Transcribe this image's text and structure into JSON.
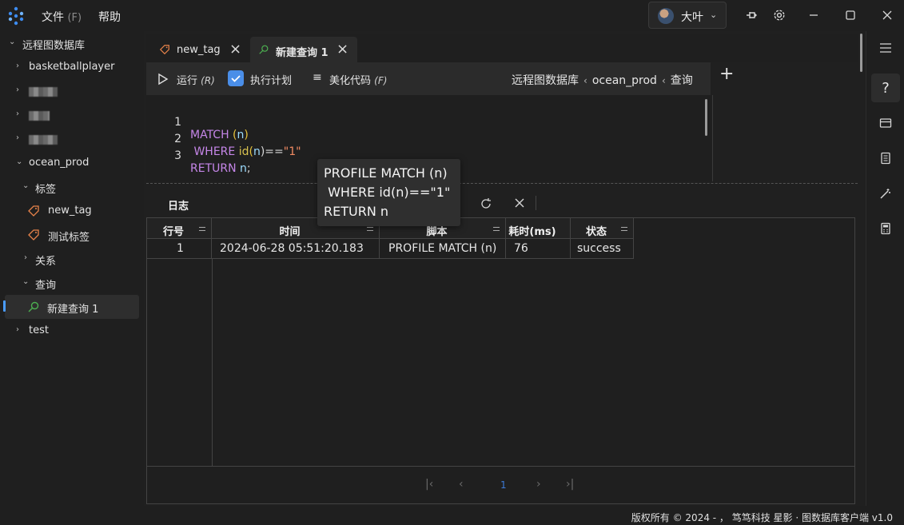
{
  "menu": {
    "file_label": "文件",
    "file_hint": "(F)",
    "help_label": "帮助"
  },
  "user": {
    "name": "大叶"
  },
  "sidebar": {
    "root": "远程图数据库",
    "items": [
      {
        "label": "basketballplayer"
      },
      {
        "label": "ocean_prod"
      },
      {
        "label": "标签"
      },
      {
        "label": "new_tag"
      },
      {
        "label": "测试标签"
      },
      {
        "label": "关系"
      },
      {
        "label": "查询"
      },
      {
        "label": "新建查询 1"
      },
      {
        "label": "test"
      }
    ]
  },
  "tabs": [
    {
      "label": "new_tag"
    },
    {
      "label": "新建查询 1"
    }
  ],
  "toolbar": {
    "run_label": "运行",
    "run_hint": "(R)",
    "plan_label": "执行计划",
    "beautify_label": "美化代码",
    "beautify_hint": "(F)",
    "breadcrumb": [
      "远程图数据库",
      "ocean_prod",
      "查询"
    ]
  },
  "editor": {
    "lines": [
      {
        "num": "1",
        "parts": [
          "MATCH",
          " (",
          "n",
          ")"
        ]
      },
      {
        "num": "2",
        "parts": [
          " WHERE ",
          "id",
          "(",
          "n",
          ")==",
          "\"1\""
        ]
      },
      {
        "num": "3",
        "parts": [
          "RETURN",
          " n",
          ";"
        ]
      }
    ]
  },
  "tooltip": {
    "text": "PROFILE MATCH (n)\n WHERE id(n)==\"1\"\nRETURN n"
  },
  "log": {
    "title": "日志",
    "columns": [
      "行号",
      "时间",
      "脚本",
      "耗时(ms)",
      "状态"
    ],
    "rows": [
      [
        "1",
        "2024-06-28 05:51:20.183",
        "PROFILE MATCH (n)",
        "76",
        "success"
      ]
    ],
    "pager": {
      "current": "1"
    }
  },
  "footer": {
    "text": "版权所有 © 2024 - ，  笃笃科技  星影 · 图数据库客户端  v1.0"
  },
  "colors": {
    "accent": "#4a8ee8",
    "keyword": "#c586e8",
    "string": "#f08a62",
    "tag_icon": "#e8834a",
    "query_icon": "#4caf50"
  }
}
